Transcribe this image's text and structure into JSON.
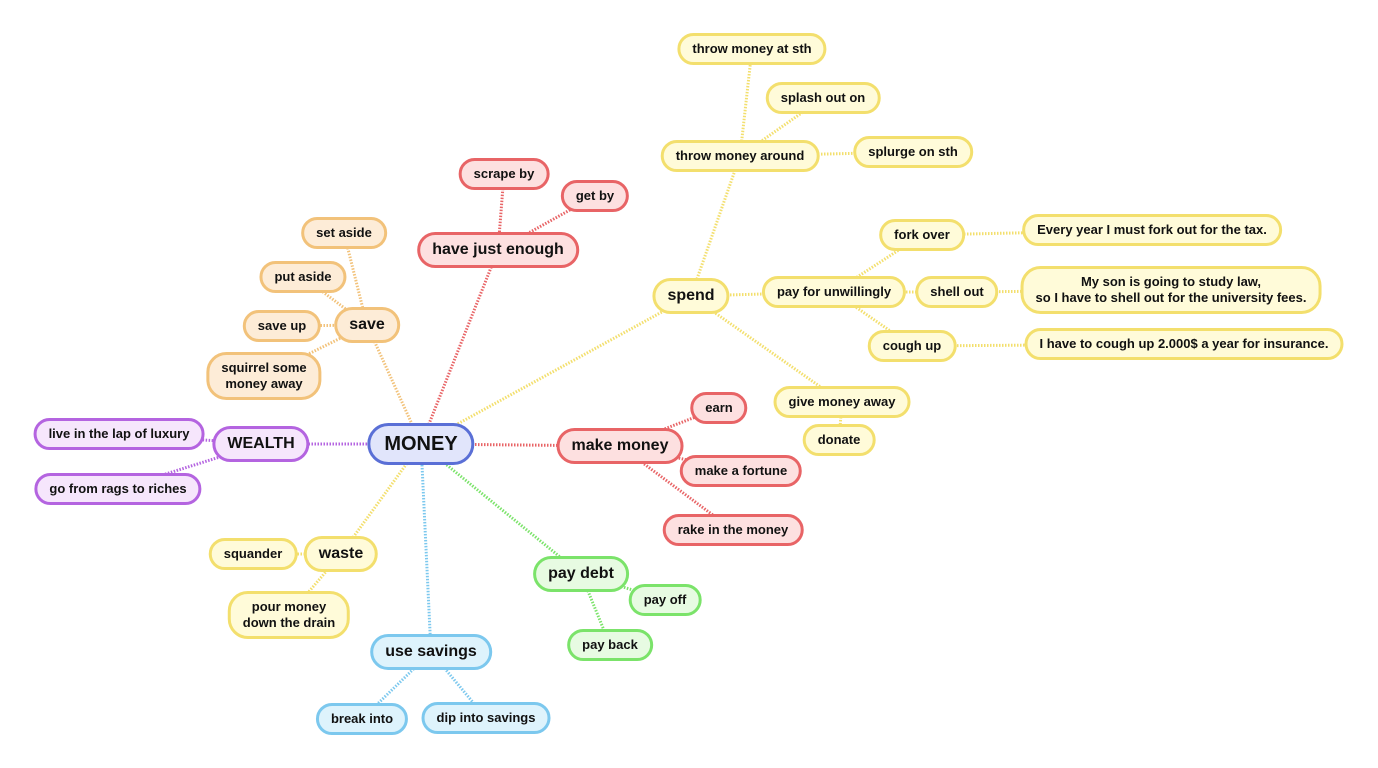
{
  "title": "MONEY",
  "colors": {
    "yellow": "#f3df6d",
    "orange": "#f2c27a",
    "red": "#e86466",
    "purple": "#b464e0",
    "green": "#7be36a",
    "blue": "#7cc8ee",
    "root": "#5a6fd6"
  },
  "nodes": {
    "money": "MONEY",
    "wealth": "WEALTH",
    "live_lap_luxury": "live in the lap of luxury",
    "rags_to_riches": "go from rags to riches",
    "save": "save",
    "set_aside": "set aside",
    "put_aside": "put aside",
    "save_up": "save up",
    "squirrel": "squirrel some\nmoney away",
    "have_just_enough": "have just enough",
    "scrape_by": "scrape by",
    "get_by": "get by",
    "spend": "spend",
    "throw_money_around": "throw money around",
    "throw_money_at": "throw money at sth",
    "splash_out": "splash out on",
    "splurge": "splurge on sth",
    "pay_unwillingly": "pay for unwillingly",
    "fork_over": "fork over",
    "shell_out": "shell out",
    "cough_up": "cough up",
    "ex_fork": "Every year I must fork out for the tax.",
    "ex_shell": "My son is going to study law,\nso I have to shell out for the university fees.",
    "ex_cough": "I have to cough up 2.000$ a year for insurance.",
    "give_away": "give money away",
    "donate": "donate",
    "make_money": "make money",
    "earn": "earn",
    "make_fortune": "make a fortune",
    "rake_in": "rake in the money",
    "pay_debt": "pay debt",
    "pay_off": "pay off",
    "pay_back": "pay back",
    "use_savings": "use savings",
    "break_into": "break into",
    "dip_into": "dip into savings",
    "waste": "waste",
    "squander": "squander",
    "pour_drain": "pour money\ndown the drain"
  }
}
